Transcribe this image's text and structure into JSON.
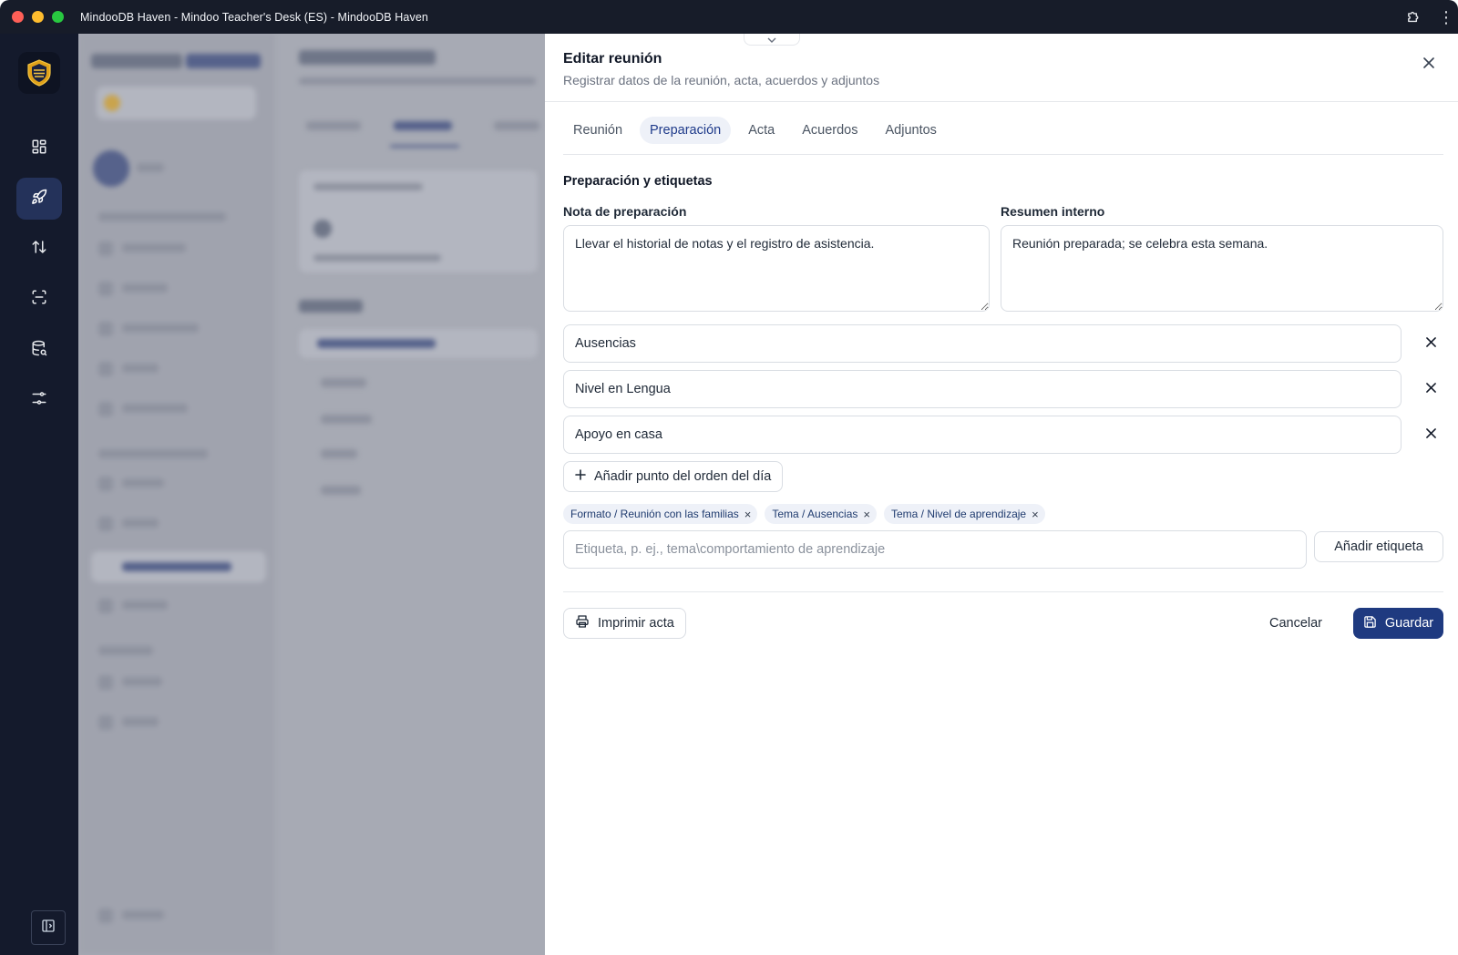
{
  "window": {
    "title": "MindooDB Haven - Mindoo Teacher's Desk (ES) - MindooDB Haven"
  },
  "rail": {
    "items": [
      {
        "icon": "grid-icon"
      },
      {
        "icon": "rocket-icon",
        "active": true
      },
      {
        "icon": "arrows-up-down-icon"
      },
      {
        "icon": "scan-icon"
      },
      {
        "icon": "database-search-icon"
      },
      {
        "icon": "sliders-icon"
      }
    ],
    "bottom_icon": "sidebar-toggle-icon"
  },
  "dialog": {
    "title": "Editar reunión",
    "subtitle": "Registrar datos de la reunión, acta, acuerdos y adjuntos",
    "tabs": [
      {
        "label": "Reunión"
      },
      {
        "label": "Preparación",
        "active": true
      },
      {
        "label": "Acta"
      },
      {
        "label": "Acuerdos"
      },
      {
        "label": "Adjuntos"
      }
    ],
    "section_title": "Preparación y etiquetas",
    "prep_note": {
      "label": "Nota de preparación",
      "value": "Llevar el historial de notas y el registro de asistencia."
    },
    "internal_summary": {
      "label": "Resumen interno",
      "value": "Reunión preparada; se celebra esta semana."
    },
    "agenda_items": [
      {
        "value": "Ausencias"
      },
      {
        "value": "Nivel en Lengua"
      },
      {
        "value": "Apoyo en casa"
      }
    ],
    "add_agenda_label": "Añadir punto del orden del día",
    "tags": [
      {
        "label": "Formato / Reunión con las familias"
      },
      {
        "label": "Tema / Ausencias"
      },
      {
        "label": "Tema / Nivel de aprendizaje"
      }
    ],
    "tag_input_placeholder": "Etiqueta, p. ej., tema\\comportamiento de aprendizaje",
    "add_tag_label": "Añadir etiqueta",
    "print_label": "Imprimir acta",
    "cancel_label": "Cancelar",
    "save_label": "Guardar"
  },
  "colors": {
    "primary": "#1f3a80",
    "tab_active_bg": "#eef1f8",
    "rail_bg": "#141a2c"
  }
}
